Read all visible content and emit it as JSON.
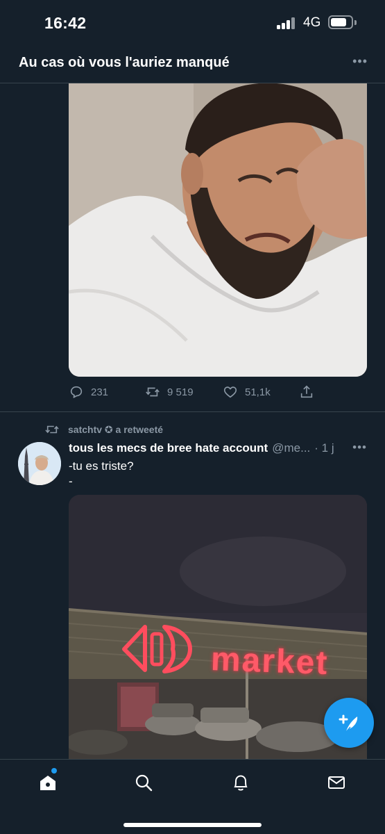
{
  "status_bar": {
    "time": "16:42",
    "network": "4G",
    "battery_level": 0.8
  },
  "header": {
    "title": "Au cas où vous l'auriez manqué",
    "more_icon": "ellipsis-icon"
  },
  "tweet1": {
    "actions": {
      "replies": "231",
      "retweets": "9 519",
      "likes": "51,1k"
    }
  },
  "tweet2": {
    "retweeted_by": "satchtv ✪ a retweeté",
    "author_name": "tous les mecs de bree hate account",
    "author_handle": "@me...",
    "time": "· 1 j",
    "text_line1": "-tu es triste?",
    "text_line2": "-",
    "sign_text": "market"
  },
  "tabbar": {
    "items": [
      "home-icon",
      "search-icon",
      "notifications-icon",
      "messages-icon"
    ],
    "home_has_new": true
  },
  "colors": {
    "background": "#15202b",
    "accent": "#1d9bf0",
    "muted": "#8b98a5",
    "divider": "#38444d"
  }
}
